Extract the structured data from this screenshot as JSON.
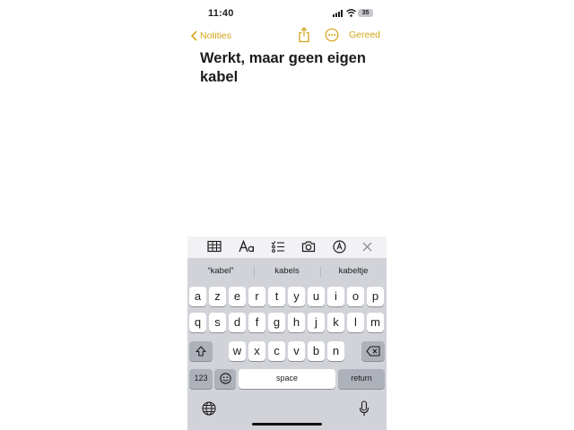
{
  "status_bar": {
    "time": "11:40",
    "battery": "35"
  },
  "nav": {
    "back_label": "Notities",
    "done_label": "Gereed"
  },
  "note": {
    "title": "Werkt, maar geen eigen kabel"
  },
  "suggestions": [
    "“kabel”",
    "kabels",
    "kabeltje"
  ],
  "keyboard": {
    "row1": [
      "a",
      "z",
      "e",
      "r",
      "t",
      "y",
      "u",
      "i",
      "o",
      "p"
    ],
    "row2": [
      "q",
      "s",
      "d",
      "f",
      "g",
      "h",
      "j",
      "k",
      "l",
      "m"
    ],
    "row3": [
      "w",
      "x",
      "c",
      "v",
      "b",
      "n"
    ],
    "numbers_label": "123",
    "space_label": "space",
    "return_label": "return"
  },
  "colors": {
    "accent": "#d4a517",
    "keyboard_bg": "#d1d3d9",
    "key_bg": "#ffffff",
    "key_dark_bg": "#adb1ba"
  }
}
